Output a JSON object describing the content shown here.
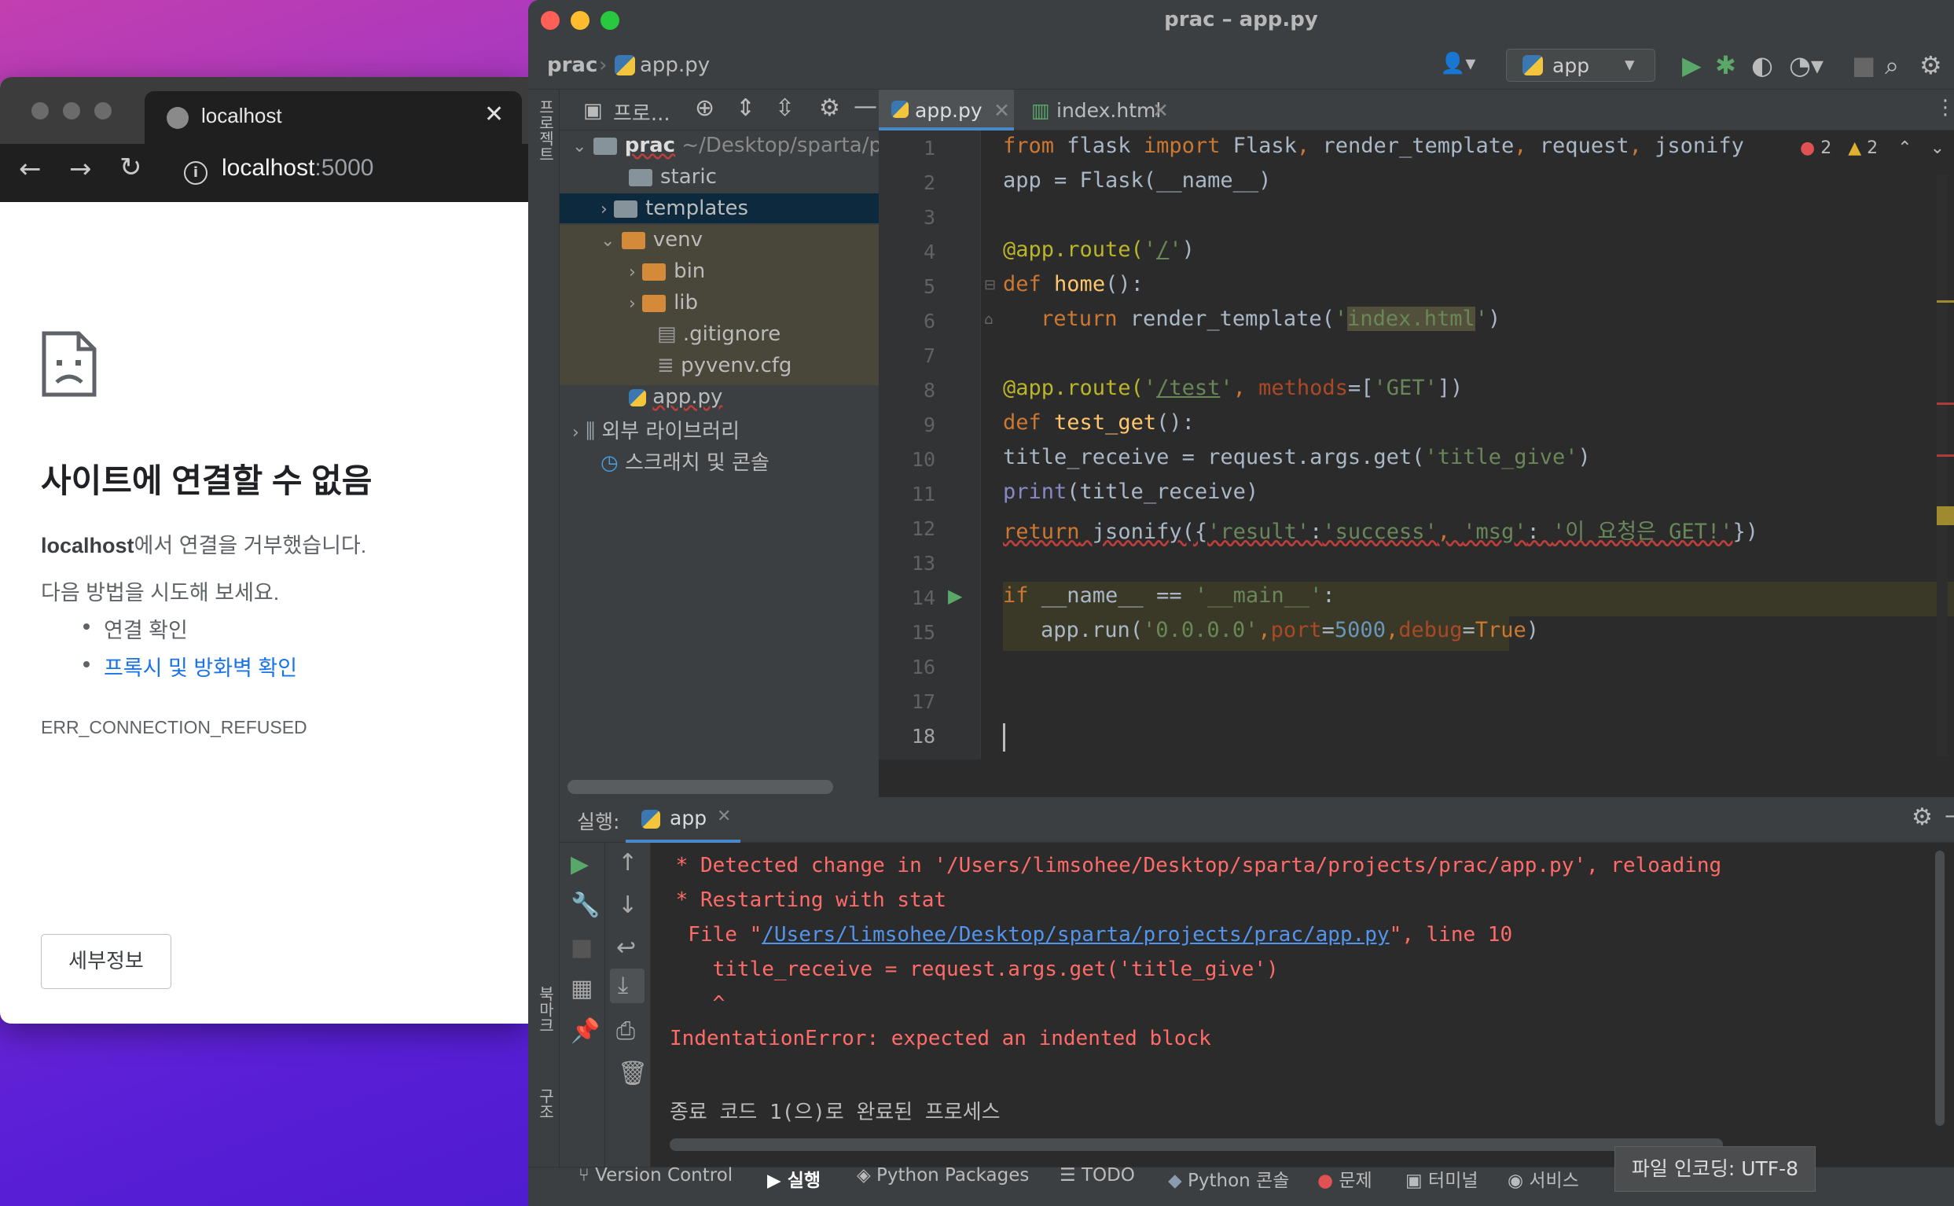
{
  "browser": {
    "tab_title": "localhost",
    "url_host": "localhost",
    "url_port": ":5000",
    "error_title": "사이트에 연결할 수 없음",
    "error_host": "localhost",
    "error_sub_rest": "에서 연결을 거부했습니다.",
    "try_label": "다음 방법을 시도해 보세요.",
    "suggestions": [
      "연결 확인",
      "프록시 및 방화벽 확인"
    ],
    "error_code": "ERR_CONNECTION_REFUSED",
    "details_label": "세부정보"
  },
  "ide": {
    "window_title": "prac – app.py",
    "breadcrumb": [
      "prac",
      "app.py"
    ],
    "run_config": "app",
    "project_panel_label": "프로...",
    "left_strip_labels": [
      "프로젝트",
      "북마크",
      "구조"
    ],
    "tree": [
      {
        "label": "prac",
        "path": "~/Desktop/sparta/proje"
      },
      {
        "label": "staric"
      },
      {
        "label": "templates"
      },
      {
        "label": "venv"
      },
      {
        "label": "bin"
      },
      {
        "label": "lib"
      },
      {
        "label": ".gitignore"
      },
      {
        "label": "pyvenv.cfg"
      },
      {
        "label": "app.py"
      },
      {
        "label": "외부 라이브러리"
      },
      {
        "label": "스크래치 및 콘솔"
      }
    ],
    "editor_tabs": [
      "app.py",
      "index.html"
    ],
    "inspections": {
      "errors": "2",
      "warnings": "2"
    },
    "line_numbers": [
      "1",
      "2",
      "3",
      "4",
      "5",
      "6",
      "7",
      "8",
      "9",
      "10",
      "11",
      "12",
      "13",
      "14",
      "15",
      "16",
      "17",
      "18"
    ],
    "code": {
      "l1": [
        "from",
        " flask ",
        "import",
        " Flask",
        ", ",
        "render_template",
        ", ",
        "request",
        ", ",
        "jsonify"
      ],
      "l2": "app = Flask(__name__)",
      "l4": [
        "@app.route(",
        "'",
        "/",
        "'",
        ")"
      ],
      "l5": [
        "def",
        " ",
        "home",
        "():"
      ],
      "l6": [
        "return",
        " render_template(",
        "'",
        "index.html",
        "'",
        ")"
      ],
      "l8": [
        "@app.route(",
        "'",
        "/test",
        "'",
        ", ",
        "methods",
        "=[",
        "'GET'",
        "])"
      ],
      "l9": [
        "def",
        " ",
        "test_get",
        "():"
      ],
      "l10": [
        "title_receive = request.args.get(",
        "'title_give'",
        ")"
      ],
      "l11": [
        "print",
        "(title_receive)"
      ],
      "l12": [
        "return",
        " jsonify({",
        "'result'",
        ":",
        "'success'",
        ", ",
        "'msg'",
        ": ",
        "'이 요청은 GET!'",
        "})"
      ],
      "l14": [
        "if",
        " __name__ == ",
        "'__main__'",
        ":"
      ],
      "l15": [
        "app.run(",
        "'0.0.0.0'",
        ",",
        "port",
        "=",
        "5000",
        ",",
        "debug",
        "=",
        "True",
        ")"
      ]
    },
    "run_panel": {
      "label": "실행:",
      "tab": "app",
      "output": [
        " * Detected change in '/Users/limsohee/Desktop/sparta/projects/prac/app.py', reloading",
        " * Restarting with stat",
        "  File \"",
        "/Users/limsohee/Desktop/sparta/projects/prac/app.py",
        "\", line 10",
        "    title_receive = request.args.get('title_give')",
        "    ^",
        "IndentationError: expected an indented block",
        "종료 코드 1(으)로 완료된 프로세스"
      ]
    },
    "bottom_tabs": [
      "Version Control",
      "실행",
      "Python Packages",
      "TODO",
      "Python 콘솔",
      "문제",
      "터미널",
      "서비스"
    ],
    "tooltip": "파일 인코딩: UTF-8"
  }
}
